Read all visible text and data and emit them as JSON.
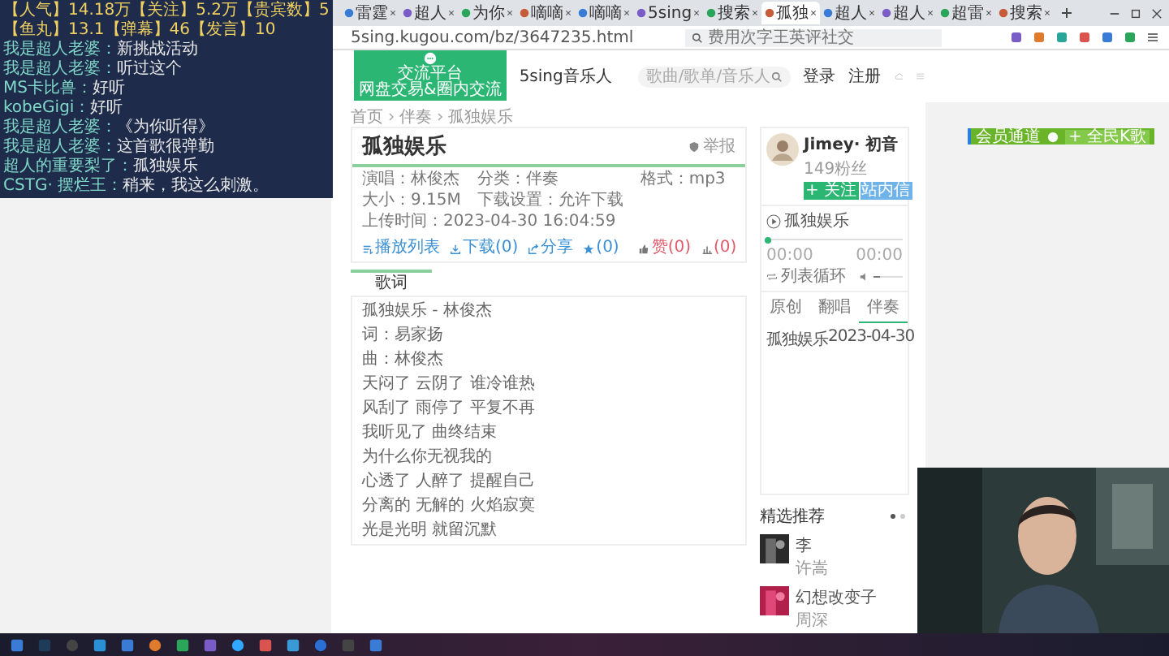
{
  "stream_overlay": {
    "stats": [
      "【人气】14.18万【关注】5.2万【贵宾数】5",
      "【鱼丸】13.1【弹幕】46【发言】10"
    ],
    "chat": [
      {
        "user": "我是超人老婆：",
        "text": "新挑战活动"
      },
      {
        "user": "我是超人老婆：",
        "text": "听过这个"
      },
      {
        "user": "MS卡比兽：",
        "text": "好听"
      },
      {
        "user": "kobeGigi：",
        "text": "好听"
      },
      {
        "user": "我是超人老婆：",
        "text": "《为你听得》"
      },
      {
        "user": "我是超人老婆：",
        "text": "这首歌很弹勤"
      },
      {
        "user": "超人的重要梨了：",
        "text": "孤独娱乐"
      },
      {
        "user": "CSTG· 摆烂王：",
        "text": "稍来，我这么刺激。"
      }
    ]
  },
  "browser": {
    "tabs": [
      {
        "label": "雷霆",
        "selected": false
      },
      {
        "label": "超人",
        "selected": false
      },
      {
        "label": "为你",
        "selected": false
      },
      {
        "label": "嘀嘀",
        "selected": false
      },
      {
        "label": "嘀嘀",
        "selected": false
      },
      {
        "label": "5sing",
        "selected": false
      },
      {
        "label": "搜索",
        "selected": false
      },
      {
        "label": "孤独",
        "selected": true
      },
      {
        "label": "超人",
        "selected": false
      },
      {
        "label": "超人",
        "selected": false
      },
      {
        "label": "超雷",
        "selected": false
      },
      {
        "label": "搜索",
        "selected": false
      }
    ],
    "address": "5sing.kugou.com/bz/3647235.html",
    "search_placeholder": "费用次字王英评社交"
  },
  "site_header": {
    "promo_title": "交流平台",
    "promo_subtitle": "网盘交易&圈内交流",
    "brand": "5sing音乐人",
    "search_placeholder": "歌曲/歌单/音乐人",
    "links": [
      "登录",
      "注册"
    ]
  },
  "breadcrumb": [
    "首页",
    "伴奏",
    "孤独娱乐"
  ],
  "song": {
    "title": "孤独娱乐",
    "report": "举报",
    "meta": [
      "演唱：林俊杰",
      "分类：伴奏",
      "格式：mp3",
      "大小：9.15M",
      "下载设置：允许下载",
      "上传时间：2023-04-30 16:04:59"
    ],
    "actions": [
      {
        "kind": "playlist",
        "label": "播放列表"
      },
      {
        "kind": "download",
        "label": "下载(0)"
      },
      {
        "kind": "share",
        "label": "分享"
      },
      {
        "kind": "star",
        "label": "(0)"
      }
    ],
    "stats": [
      {
        "kind": "like",
        "label": "赞(0)"
      },
      {
        "kind": "chart",
        "label": "(0)"
      }
    ]
  },
  "lyrics": {
    "tab": "歌词",
    "lines": [
      "孤独娱乐 - 林俊杰",
      "词：易家扬",
      "曲：林俊杰",
      "天闷了 云阴了 谁冷谁热",
      "风刮了 雨停了 平复不再",
      "我听见了 曲终结束",
      "为什么你无视我的",
      "心透了 人醉了 提醒自己",
      "分离的 无解的 火焰寂寞",
      "光是光明 就留沉默"
    ]
  },
  "artist": {
    "name": "Jimey· 初音",
    "fans": "149粉丝",
    "follow": "+ 关注",
    "message": "站内信"
  },
  "player": {
    "track": "孤独娱乐",
    "elapsed": "00:00",
    "total": "00:00",
    "level": 0,
    "mode": "列表循环",
    "volume": {
      "level": 0.2
    }
  },
  "side_tabs": [
    {
      "label": "原创",
      "selected": false
    },
    {
      "label": "翻唱",
      "selected": false
    },
    {
      "label": "伴奏",
      "selected": true
    }
  ],
  "side_rows": [
    {
      "title": "孤独娱乐",
      "date": "2023-04-30"
    }
  ],
  "picks": {
    "title": "精选推荐",
    "items": [
      {
        "title": "李",
        "artist": "许嵩"
      },
      {
        "title": "幻想改变子",
        "artist": "周深"
      }
    ]
  },
  "ad": {
    "label": "会员通道",
    "button": "+ 全民K歌"
  }
}
